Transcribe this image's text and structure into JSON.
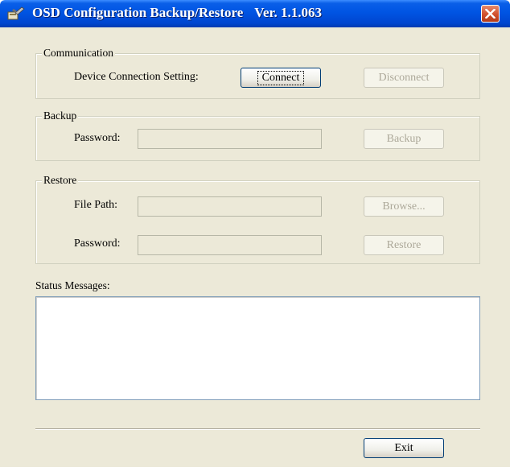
{
  "window": {
    "title": "OSD Configuration Backup/Restore",
    "version": "Ver. 1.1.063",
    "close_symbol": "✕",
    "icon": "app-tools-icon",
    "colors": {
      "titlebar": "#0054e3",
      "body": "#ece9d8",
      "close": "#d1502e"
    }
  },
  "communication": {
    "title": "Communication",
    "setting_label": "Device Connection Setting:",
    "connect_label": "Connect",
    "disconnect_label": "Disconnect"
  },
  "backup": {
    "title": "Backup",
    "password_label": "Password:",
    "password_value": "",
    "backup_label": "Backup"
  },
  "restore": {
    "title": "Restore",
    "filepath_label": "File Path:",
    "filepath_value": "",
    "browse_label": "Browse...",
    "password_label": "Password:",
    "password_value": "",
    "restore_label": "Restore"
  },
  "status": {
    "label": "Status Messages:",
    "text": ""
  },
  "footer": {
    "exit_label": "Exit"
  }
}
